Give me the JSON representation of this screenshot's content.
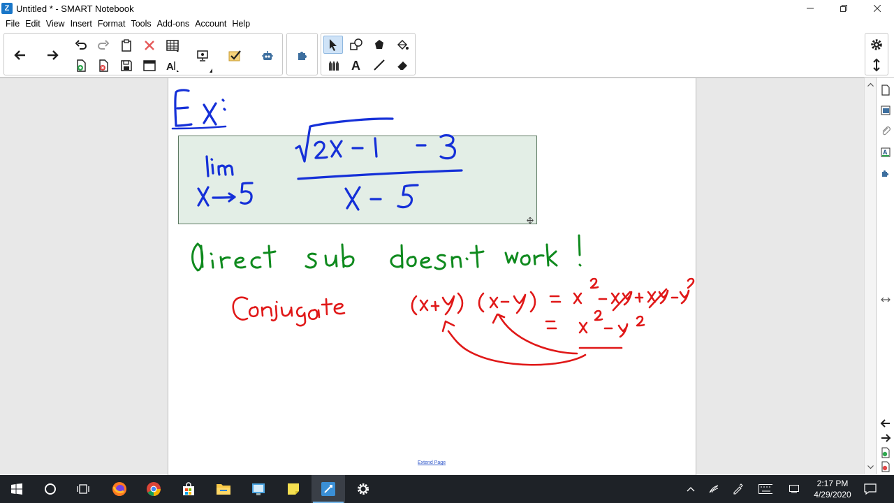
{
  "window": {
    "title": "Untitled * - SMART Notebook",
    "app_icon_glyph": "Z"
  },
  "menu": [
    "File",
    "Edit",
    "View",
    "Insert",
    "Format",
    "Tools",
    "Add-ons",
    "Account",
    "Help"
  ],
  "toolbar": {
    "active_tool": "select",
    "accent": "#1a63c2"
  },
  "page": {
    "extend_label": "Extend Page"
  },
  "ink": {
    "blue": "#1530d8",
    "green": "#0f8a1e",
    "red": "#e01818",
    "box_fill": "#e3eee6",
    "box_border": "#5e7a63"
  },
  "taskbar": {
    "time": "2:17 PM",
    "date": "4/29/2020"
  }
}
